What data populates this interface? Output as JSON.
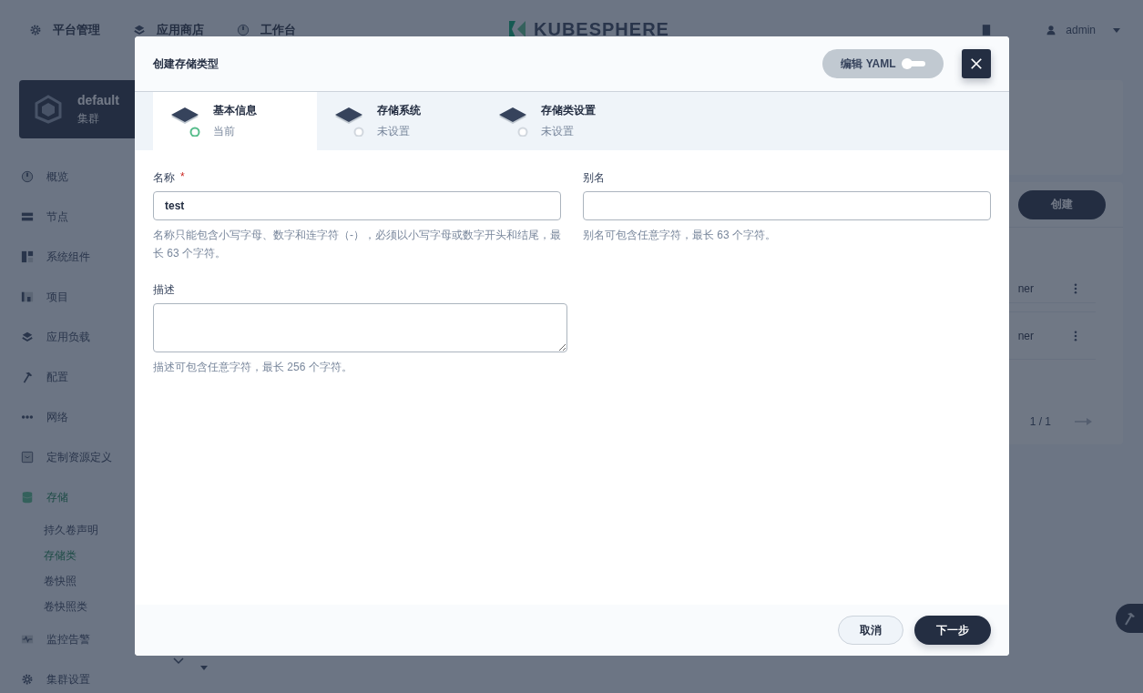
{
  "topnav": {
    "items": [
      {
        "label": "平台管理"
      },
      {
        "label": "应用商店"
      },
      {
        "label": "工作台"
      }
    ],
    "logo": "KUBESPHERE",
    "user": "admin"
  },
  "sidebar": {
    "cluster": {
      "name": "default",
      "type": "集群"
    },
    "items": [
      {
        "label": "概览",
        "selected": false
      },
      {
        "label": "节点",
        "selected": false
      },
      {
        "label": "系统组件",
        "selected": false
      },
      {
        "label": "项目",
        "selected": false
      },
      {
        "label": "应用负载",
        "selected": false
      },
      {
        "label": "配置",
        "selected": false
      },
      {
        "label": "网络",
        "selected": false
      },
      {
        "label": "定制资源定义",
        "selected": false
      },
      {
        "label": "存储",
        "selected": true,
        "children": [
          {
            "label": "持久卷声明",
            "selected": false
          },
          {
            "label": "存储类",
            "selected": true
          },
          {
            "label": "卷快照",
            "selected": false
          },
          {
            "label": "卷快照类",
            "selected": false
          }
        ]
      },
      {
        "label": "监控告警",
        "selected": false
      },
      {
        "label": "集群设置",
        "selected": false
      }
    ]
  },
  "content": {
    "create_button": "创建",
    "rows": [
      {
        "column_1": "ner"
      },
      {
        "column_1": "ner"
      }
    ],
    "pagination": "1 / 1"
  },
  "modal": {
    "title": "创建存储类型",
    "yaml_toggle": {
      "label": "编辑 YAML",
      "on": false
    },
    "steps": [
      {
        "title": "基本信息",
        "status": "当前",
        "selected": true
      },
      {
        "title": "存储系统",
        "status": "未设置",
        "selected": false
      },
      {
        "title": "存储类设置",
        "status": "未设置",
        "selected": false
      }
    ],
    "fields": [
      {
        "kind": "input",
        "label": "名称",
        "required_mark": "*",
        "value": "test",
        "hint": "名称只能包含小写字母、数字和连字符（-），必须以小写字母或数字开头和结尾，最长 63 个字符。"
      },
      {
        "kind": "input",
        "label": "别名",
        "hint": "别名可包含任意字符，最长 63 个字符。"
      },
      {
        "kind": "textarea",
        "label": "描述",
        "hint": "描述可包含任意字符，最长 256 个字符。"
      }
    ],
    "buttons": {
      "cancel": "取消",
      "next": "下一步"
    }
  }
}
